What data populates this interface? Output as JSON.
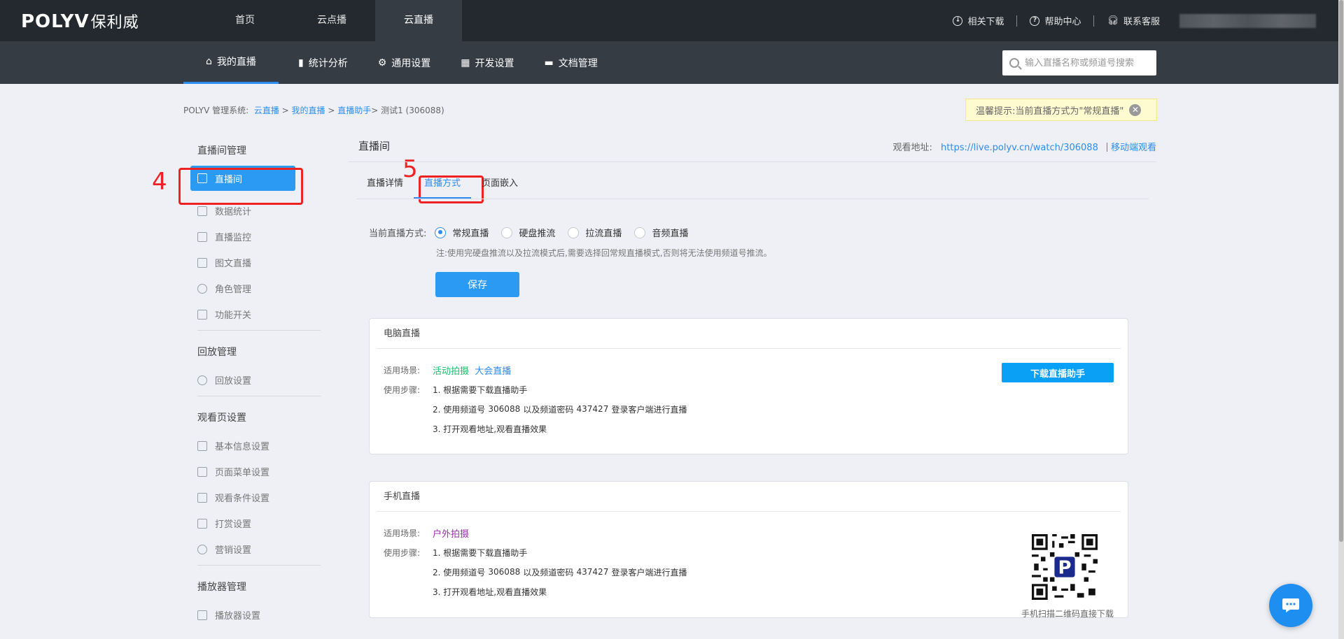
{
  "topbar": {
    "logo_text": "POLYV",
    "logo_cn": "保利威",
    "nav": [
      {
        "label": "首页",
        "active": false
      },
      {
        "label": "云点播",
        "active": false
      },
      {
        "label": "云直播",
        "active": true
      }
    ],
    "right_links": [
      {
        "label": "相关下载",
        "icon": "download-icon"
      },
      {
        "label": "帮助中心",
        "icon": "help-icon"
      },
      {
        "label": "联系客服",
        "icon": "headset-icon"
      }
    ]
  },
  "subnav": {
    "items": [
      {
        "label": "我的直播",
        "icon": "home-icon",
        "active": true
      },
      {
        "label": "统计分析",
        "icon": "bar-chart-icon",
        "active": false
      },
      {
        "label": "通用设置",
        "icon": "gear-icon",
        "active": false
      },
      {
        "label": "开发设置",
        "icon": "grid-icon",
        "active": false
      },
      {
        "label": "文档管理",
        "icon": "folder-icon",
        "active": false
      }
    ],
    "search_placeholder": "输入直播名称或频道号搜索"
  },
  "breadcrumb": {
    "prefix": "POLYV 管理系统:",
    "links": [
      "云直播",
      "我的直播",
      "直播助手"
    ],
    "current": "测试1 (306088)"
  },
  "tip": {
    "text": "温馨提示:当前直播方式为\"常规直播\""
  },
  "sidebar": {
    "group1": "直播间管理",
    "group1_items": [
      "直播间",
      "数据统计",
      "直播监控",
      "图文直播",
      "角色管理",
      "功能开关"
    ],
    "group2": "回放管理",
    "group2_items": [
      "回放设置"
    ],
    "group3": "观看页设置",
    "group3_items": [
      "基本信息设置",
      "页面菜单设置",
      "观看条件设置",
      "打赏设置",
      "营销设置"
    ],
    "group4": "播放器管理",
    "group4_items": [
      "播放器设置"
    ]
  },
  "annotations": {
    "label4": "4",
    "label5": "5"
  },
  "main": {
    "title": "直播间",
    "watch_label": "观看地址:",
    "watch_url": "https://live.polyv.cn/watch/306088",
    "mobile_watch": "移动端观看",
    "tabs": [
      "直播详情",
      "直播方式",
      "页面嵌入"
    ],
    "mode_label": "当前直播方式:",
    "modes": [
      {
        "label": "常规直播",
        "checked": true
      },
      {
        "label": "硬盘推流",
        "checked": false
      },
      {
        "label": "拉流直播",
        "checked": false
      },
      {
        "label": "音频直播",
        "checked": false
      }
    ],
    "note": "注:使用完硬盘推流以及拉流模式后,需要选择回常规直播模式,否则将无法使用频道号推流。",
    "save_label": "保存"
  },
  "pc_card": {
    "title": "电脑直播",
    "scene_label": "适用场景:",
    "scenes": [
      "活动拍摄",
      "大会直播"
    ],
    "steps_label": "使用步骤:",
    "step1": "1. 根据需要下载直播助手",
    "step2_a": "2. 使用频道号",
    "channel": "306088",
    "step2_b": "以及频道密码",
    "password": "437427",
    "step2_c": "登录客户端进行直播",
    "step3": "3. 打开观看地址,观看直播效果",
    "download_label": "下载直播助手"
  },
  "mobile_card": {
    "title": "手机直播",
    "scene_label": "适用场景:",
    "scene": "户外拍摄",
    "steps_label": "使用步骤:",
    "step1": "1. 根据需要下载直播助手",
    "step2_a": "2. 使用频道号",
    "channel": "306088",
    "step2_b": "以及频道密码",
    "password": "437427",
    "step2_c": "登录客户端进行直播",
    "step3": "3. 打开观看地址,观看直播效果",
    "qr_caption": "手机扫描二维码直接下载"
  }
}
